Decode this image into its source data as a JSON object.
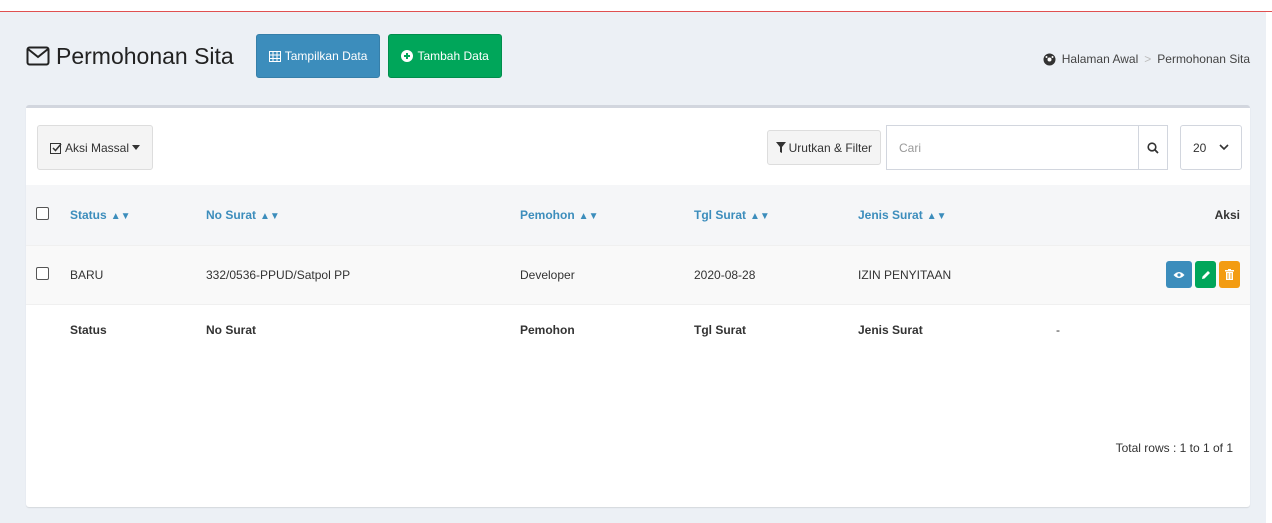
{
  "header": {
    "title": "Permohonan Sita",
    "btn_show": "Tampilkan Data",
    "btn_add": "Tambah Data"
  },
  "breadcrumb": {
    "home": "Halaman Awal",
    "sep": ">",
    "current": "Permohonan Sita"
  },
  "toolbar": {
    "bulk_label": "Aksi Massal",
    "filter_label": "Urutkan & Filter",
    "search_placeholder": "Cari",
    "page_size": "20"
  },
  "table": {
    "columns": [
      "Status",
      "No Surat",
      "Pemohon",
      "Tgl Surat",
      "Jenis Surat",
      "Aksi"
    ],
    "rows": [
      {
        "status": "BARU",
        "no_surat": "332/0536-PPUD/Satpol PP",
        "pemohon": "Developer",
        "tgl_surat": "2020-08-28",
        "jenis_surat": "IZIN PENYITAAN"
      }
    ],
    "footer": {
      "status": "Status",
      "no_surat": "No Surat",
      "pemohon": "Pemohon",
      "tgl_surat": "Tgl Surat",
      "jenis_surat": "Jenis Surat",
      "aksi": "-"
    }
  },
  "total_rows": "Total rows : 1 to 1 of 1",
  "colors": {
    "primary": "#3c8dbc",
    "success": "#00a65a",
    "warning": "#f39c12"
  }
}
